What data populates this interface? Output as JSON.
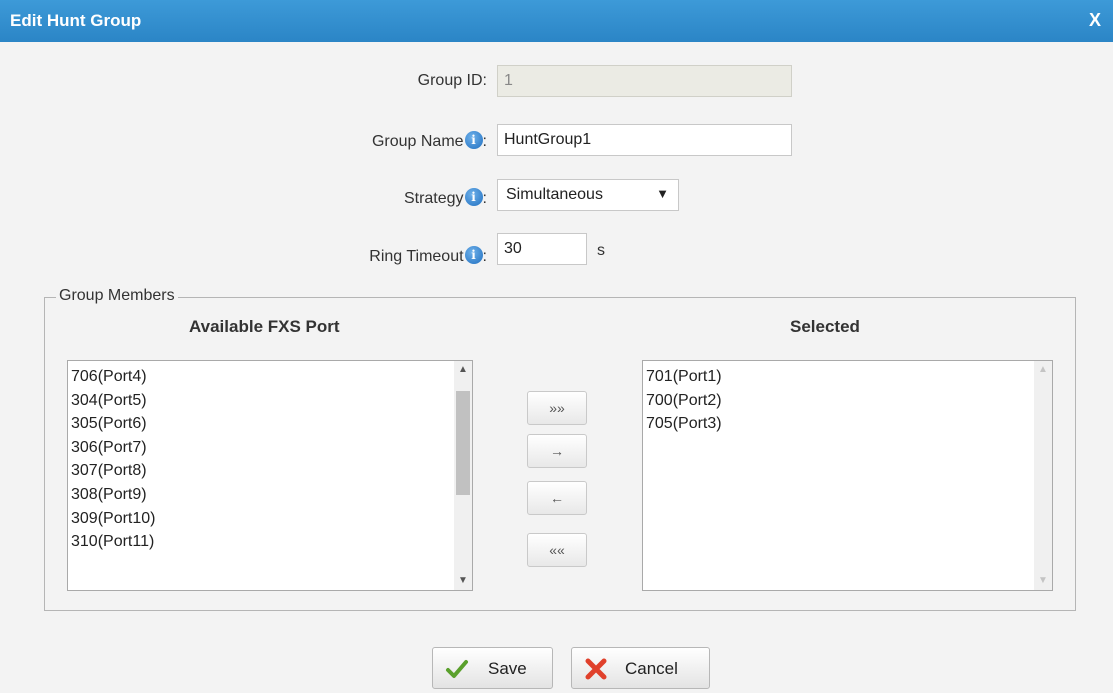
{
  "dialog": {
    "title": "Edit Hunt Group",
    "close_label": "X"
  },
  "form": {
    "group_id": {
      "label": "Group ID:",
      "value": "1"
    },
    "group_name": {
      "label": "Group Name",
      "suffix": ":",
      "value": "HuntGroup1"
    },
    "strategy": {
      "label": "Strategy",
      "suffix": ":",
      "value": "Simultaneous"
    },
    "ring_timeout": {
      "label": "Ring Timeout",
      "suffix": ":",
      "value": "30",
      "unit": "s"
    }
  },
  "members": {
    "legend": "Group Members",
    "available_header": "Available FXS Port",
    "selected_header": "Selected",
    "available": [
      "706(Port4)",
      "304(Port5)",
      "305(Port6)",
      "306(Port7)",
      "307(Port8)",
      "308(Port9)",
      "309(Port10)",
      "310(Port11)"
    ],
    "selected": [
      "701(Port1)",
      "700(Port2)",
      "705(Port3)"
    ],
    "buttons": {
      "add_all": "»»",
      "add": "→",
      "remove": "←",
      "remove_all": "««"
    }
  },
  "footer": {
    "save_label": "Save",
    "cancel_label": "Cancel"
  },
  "colors": {
    "titlebar": "#2b85c6",
    "info_icon": "#1f6fc0",
    "save_check": "#5aa02c",
    "cancel_x": "#e0402b"
  },
  "icons": {
    "info": "info-icon",
    "save": "checkmark-icon",
    "cancel": "x-icon"
  }
}
